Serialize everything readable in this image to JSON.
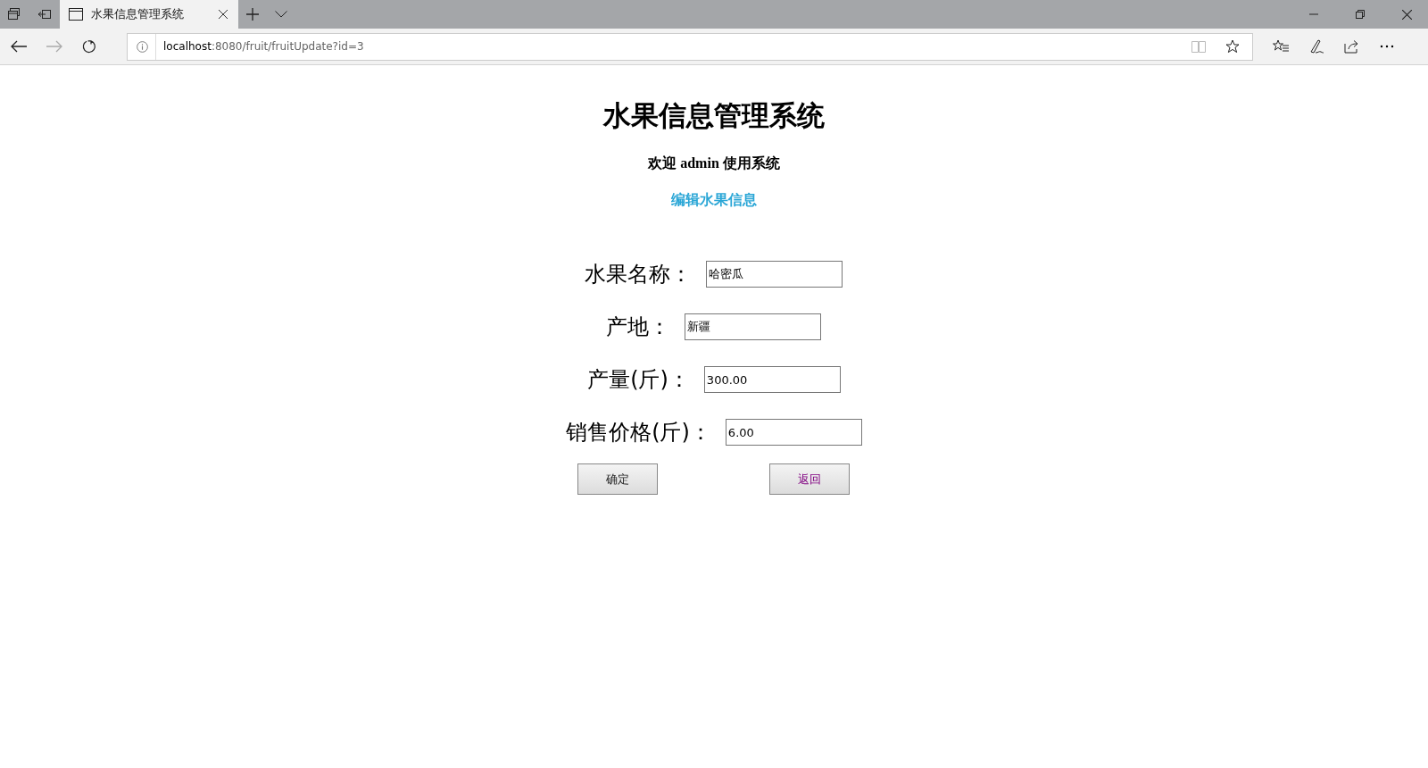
{
  "browser": {
    "tab": {
      "title": "水果信息管理系统",
      "selected": true
    },
    "url": {
      "host": "localhost",
      "path": ":8080/fruit/fruitUpdate?id=3"
    }
  },
  "page": {
    "title": "水果信息管理系统",
    "welcome": "欢迎 admin 使用系统",
    "section_link": "编辑水果信息",
    "fields": [
      {
        "label": "水果名称：",
        "value": "哈密瓜"
      },
      {
        "label": "产地：",
        "value": "新疆"
      },
      {
        "label": "产量(斤)：",
        "value": "300.00"
      },
      {
        "label": "销售价格(斤)：",
        "value": "6.00"
      }
    ],
    "buttons": [
      {
        "label": "确定",
        "kind": "submit"
      },
      {
        "label": "返回",
        "kind": "link"
      }
    ]
  }
}
